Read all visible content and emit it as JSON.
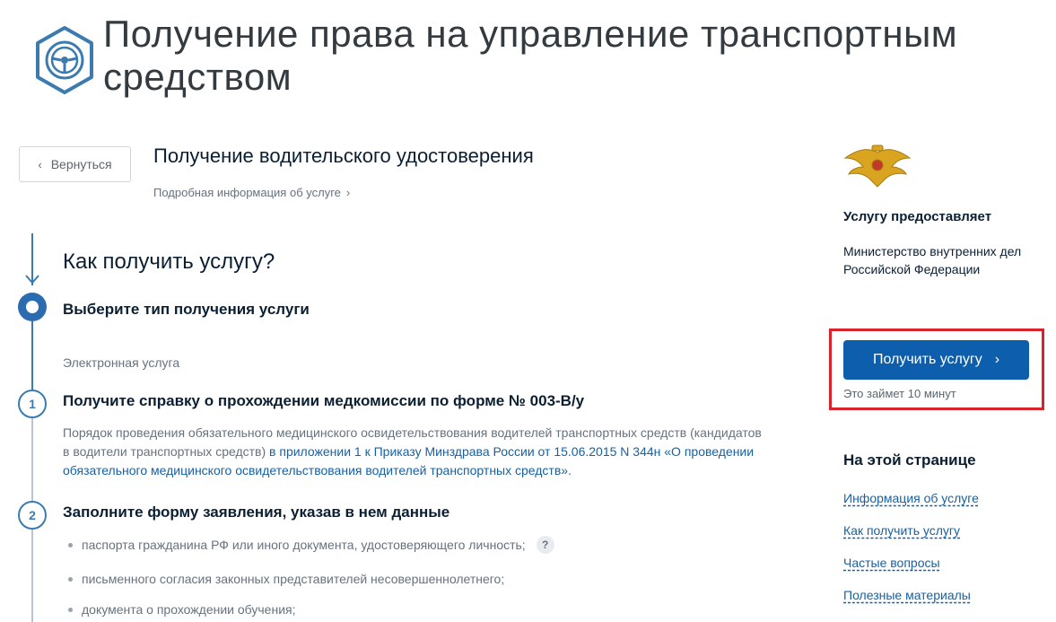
{
  "header": {
    "title": "Получение права на управление транспортным средством",
    "logo_icon": "steering-wheel-icon"
  },
  "service": {
    "back_label": "Вернуться",
    "title": "Получение водительского удостоверения",
    "more_label": "Подробная информация об услуге"
  },
  "how": {
    "title": "Как получить услугу?",
    "step0": {
      "title": "Выберите тип получения услуги",
      "option": "Электронная услуга"
    },
    "step1": {
      "number": "1",
      "title": "Получите справку о прохождении медкомиссии по форме № 003-В/у",
      "desc_text": "Порядок проведения обязательного медицинского освидетельствования водителей транспортных средств (кандидатов в водители транспортных средств) ",
      "desc_link": "в приложении 1 к Приказу Минздрава России от 15.06.2015 N 344н «О проведении обязательного медицинского освидетельствования водителей транспортных средств»."
    },
    "step2": {
      "number": "2",
      "title": "Заполните форму заявления, указав в нем данные",
      "items": [
        "паспорта гражданина РФ или иного документа, удостоверяющего личность;",
        "письменного согласия законных представителей несовершеннолетнего;",
        "документа о прохождении обучения;"
      ],
      "help_label": "?"
    }
  },
  "sidebar": {
    "emblem_icon": "double-headed-eagle-emblem",
    "provider_title": "Услугу предоставляет",
    "provider_name": "Министерство внутренних дел Российской Федерации",
    "cta_label": "Получить услугу",
    "cta_note": "Это займет 10 минут",
    "on_page_title": "На этой странице",
    "links": [
      "Информация об услуге",
      "Как получить услугу",
      "Частые вопросы",
      "Полезные материалы"
    ]
  },
  "colors": {
    "primary": "#0d5fad",
    "link": "#1561a6",
    "highlight": "#d8232a",
    "timeline": "#3b7bb0"
  }
}
